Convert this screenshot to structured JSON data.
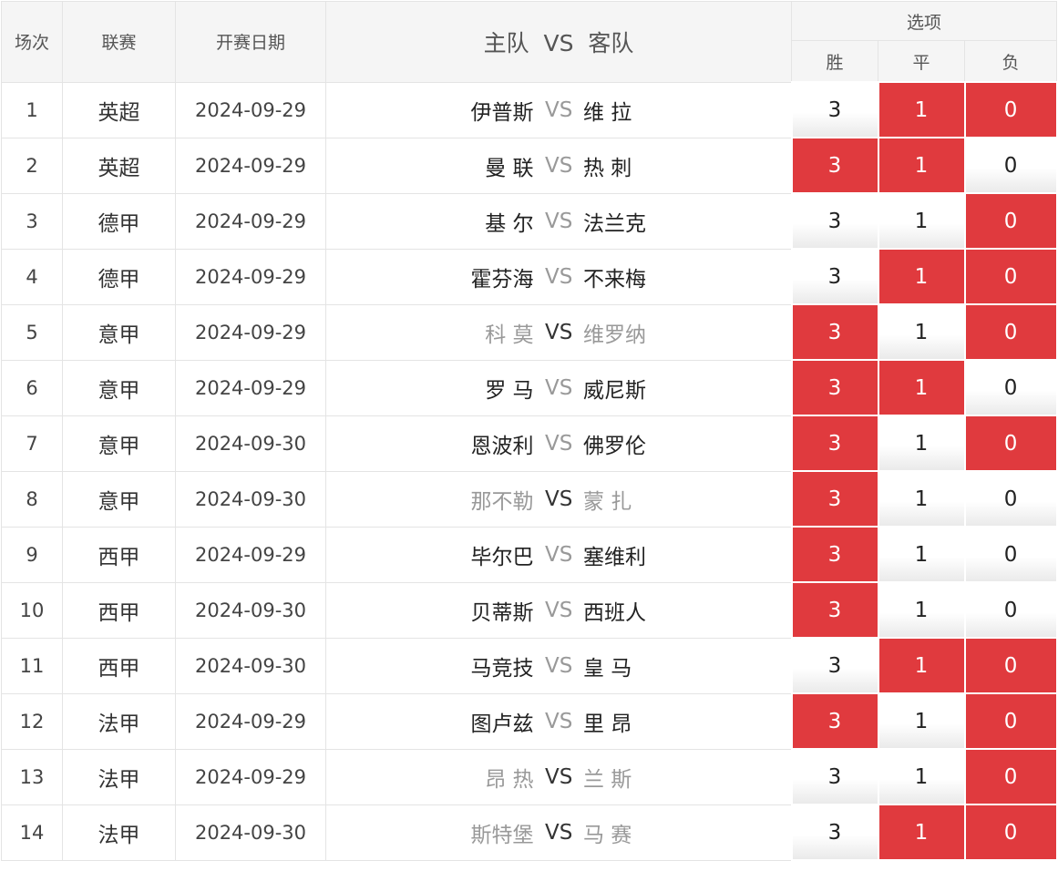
{
  "header": {
    "col_index": "场次",
    "col_league": "联赛",
    "col_date": "开赛日期",
    "col_home": "主队",
    "col_vs": "VS",
    "col_away": "客队",
    "col_options": "选项",
    "opt_win": "胜",
    "opt_draw": "平",
    "opt_lose": "负"
  },
  "colors": {
    "selected": "#e03a3e",
    "muted": "#999999"
  },
  "rows": [
    {
      "no": "1",
      "league": "英超",
      "date": "2024-09-29",
      "home": "伊普斯",
      "away": "维 拉",
      "vs": "VS",
      "win": "3",
      "draw": "1",
      "lose": "0",
      "sel": [
        false,
        true,
        true
      ],
      "muted": "vs"
    },
    {
      "no": "2",
      "league": "英超",
      "date": "2024-09-29",
      "home": "曼 联",
      "away": "热 刺",
      "vs": "VS",
      "win": "3",
      "draw": "1",
      "lose": "0",
      "sel": [
        true,
        true,
        false
      ],
      "muted": "vs"
    },
    {
      "no": "3",
      "league": "德甲",
      "date": "2024-09-29",
      "home": "基 尔",
      "away": "法兰克",
      "vs": "VS",
      "win": "3",
      "draw": "1",
      "lose": "0",
      "sel": [
        false,
        false,
        true
      ],
      "muted": "vs"
    },
    {
      "no": "4",
      "league": "德甲",
      "date": "2024-09-29",
      "home": "霍芬海",
      "away": "不来梅",
      "vs": "VS",
      "win": "3",
      "draw": "1",
      "lose": "0",
      "sel": [
        false,
        true,
        true
      ],
      "muted": "vs"
    },
    {
      "no": "5",
      "league": "意甲",
      "date": "2024-09-29",
      "home": "科 莫",
      "away": "维罗纳",
      "vs": "VS",
      "win": "3",
      "draw": "1",
      "lose": "0",
      "sel": [
        true,
        false,
        true
      ],
      "muted": "teams"
    },
    {
      "no": "6",
      "league": "意甲",
      "date": "2024-09-29",
      "home": "罗 马",
      "away": "威尼斯",
      "vs": "VS",
      "win": "3",
      "draw": "1",
      "lose": "0",
      "sel": [
        true,
        true,
        false
      ],
      "muted": "vs"
    },
    {
      "no": "7",
      "league": "意甲",
      "date": "2024-09-30",
      "home": "恩波利",
      "away": "佛罗伦",
      "vs": "VS",
      "win": "3",
      "draw": "1",
      "lose": "0",
      "sel": [
        true,
        false,
        true
      ],
      "muted": "vs"
    },
    {
      "no": "8",
      "league": "意甲",
      "date": "2024-09-30",
      "home": "那不勒",
      "away": "蒙 扎",
      "vs": "VS",
      "win": "3",
      "draw": "1",
      "lose": "0",
      "sel": [
        true,
        false,
        false
      ],
      "muted": "teams"
    },
    {
      "no": "9",
      "league": "西甲",
      "date": "2024-09-29",
      "home": "毕尔巴",
      "away": "塞维利",
      "vs": "VS",
      "win": "3",
      "draw": "1",
      "lose": "0",
      "sel": [
        true,
        false,
        false
      ],
      "muted": "vs"
    },
    {
      "no": "10",
      "league": "西甲",
      "date": "2024-09-30",
      "home": "贝蒂斯",
      "away": "西班人",
      "vs": "VS",
      "win": "3",
      "draw": "1",
      "lose": "0",
      "sel": [
        true,
        false,
        false
      ],
      "muted": "vs"
    },
    {
      "no": "11",
      "league": "西甲",
      "date": "2024-09-30",
      "home": "马竞技",
      "away": "皇 马",
      "vs": "VS",
      "win": "3",
      "draw": "1",
      "lose": "0",
      "sel": [
        false,
        true,
        true
      ],
      "muted": "vs"
    },
    {
      "no": "12",
      "league": "法甲",
      "date": "2024-09-29",
      "home": "图卢兹",
      "away": "里 昂",
      "vs": "VS",
      "win": "3",
      "draw": "1",
      "lose": "0",
      "sel": [
        true,
        false,
        true
      ],
      "muted": "vs"
    },
    {
      "no": "13",
      "league": "法甲",
      "date": "2024-09-29",
      "home": "昂 热",
      "away": "兰 斯",
      "vs": "VS",
      "win": "3",
      "draw": "1",
      "lose": "0",
      "sel": [
        false,
        false,
        true
      ],
      "muted": "teams"
    },
    {
      "no": "14",
      "league": "法甲",
      "date": "2024-09-30",
      "home": "斯特堡",
      "away": "马 赛",
      "vs": "VS",
      "win": "3",
      "draw": "1",
      "lose": "0",
      "sel": [
        false,
        true,
        true
      ],
      "muted": "teams"
    }
  ]
}
